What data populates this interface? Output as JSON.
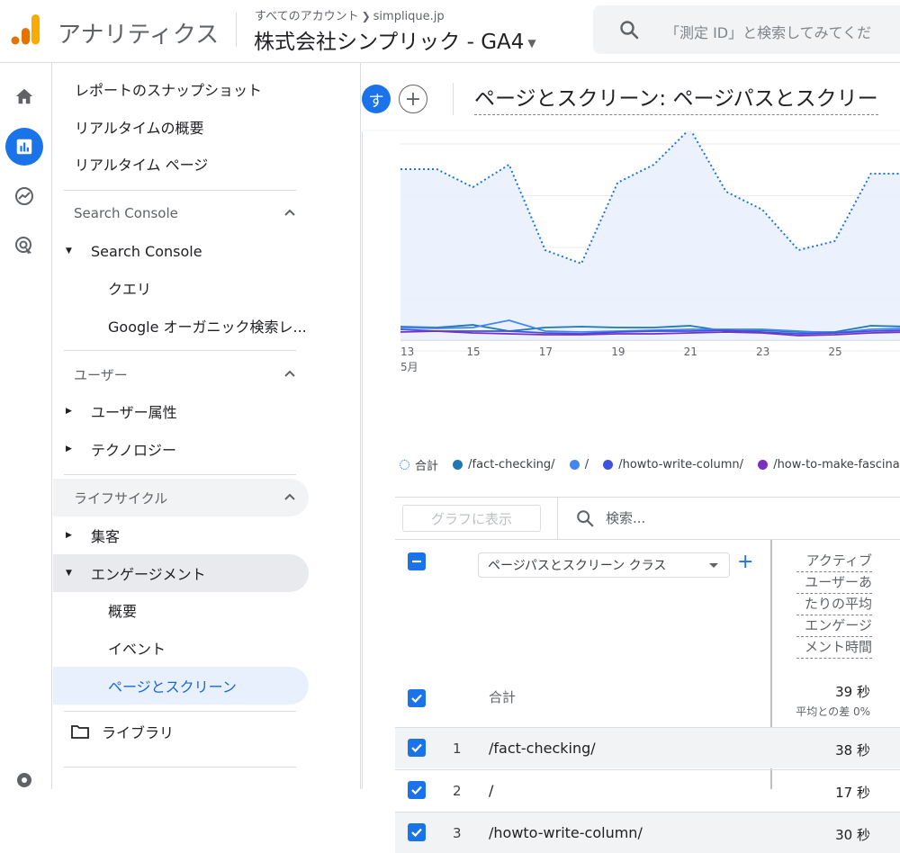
{
  "header": {
    "app_title": "アナリティクス",
    "account_path": "すべてのアカウント",
    "account_name": "simplique.jp",
    "property_name": "株式会社シンプリック - GA4",
    "search_placeholder": "「測定 ID」と検索してみてくだ"
  },
  "rail": {
    "items": [
      {
        "icon": "home-icon"
      },
      {
        "icon": "reports-icon",
        "active": true
      },
      {
        "icon": "explore-icon"
      },
      {
        "icon": "advertising-icon"
      },
      {
        "icon": "settings-icon"
      }
    ]
  },
  "nav": {
    "top_items": [
      "レポートのスナップショット",
      "リアルタイムの概要",
      "リアルタイム ページ"
    ],
    "sections": {
      "search_console": {
        "title": "Search Console",
        "group": "Search Console",
        "items": [
          "クエリ",
          "Google オーガニック検索レ..."
        ]
      },
      "user": {
        "title": "ユーザー",
        "items": [
          "ユーザー属性",
          "テクノロジー"
        ]
      },
      "lifecycle": {
        "title": "ライフサイクル",
        "items": [
          "集客",
          "エンゲージメント"
        ],
        "engagement_items": [
          "概要",
          "イベント",
          "ページとスクリーン"
        ]
      }
    },
    "library": "ライブラリ"
  },
  "main": {
    "avatar_letter": "す",
    "add_label": "+",
    "page_title": "ページとスクリーン: ページパスとスクリー"
  },
  "chart_data": {
    "type": "line",
    "x": [
      "13",
      "14",
      "15",
      "16",
      "17",
      "18",
      "19",
      "20",
      "21",
      "22",
      "23",
      "24",
      "25",
      "26",
      "27"
    ],
    "x_tick_labels": [
      "13",
      "15",
      "17",
      "19",
      "21",
      "23",
      "25"
    ],
    "x_month_label": "5月",
    "y_gridlines": 4,
    "ylim": [
      0,
      230
    ],
    "series": [
      {
        "name": "合計",
        "style": "dotted-area",
        "color": "#1a73e8",
        "values": [
          190,
          190,
          170,
          195,
          100,
          85,
          175,
          195,
          235,
          165,
          145,
          100,
          110,
          185,
          185
        ]
      },
      {
        "name": "/fact-checking/",
        "color": "#1f77b4",
        "values": [
          15,
          14,
          17,
          10,
          14,
          15,
          14,
          14,
          16,
          10,
          11,
          9,
          9,
          16,
          15
        ]
      },
      {
        "name": "/",
        "color": "#4285f4",
        "values": [
          14,
          13,
          14,
          22,
          10,
          9,
          10,
          11,
          12,
          12,
          12,
          10,
          8,
          12,
          13
        ]
      },
      {
        "name": "/howto-write-column/",
        "color": "#3f51e0",
        "values": [
          12,
          10,
          10,
          10,
          8,
          7,
          9,
          10,
          10,
          11,
          9,
          7,
          8,
          10,
          11
        ]
      },
      {
        "name": "/how-to-make-fascinating-",
        "color": "#7b2fbe",
        "values": [
          9,
          10,
          8,
          7,
          6,
          6,
          7,
          7,
          8,
          9,
          8,
          5,
          6,
          8,
          9
        ]
      }
    ],
    "legend_position": "bottom"
  },
  "filter": {
    "graph_button": "グラフに表示",
    "search_placeholder": "検索..."
  },
  "table": {
    "dimension_label": "ページパスとスクリーン クラス",
    "metric_header": [
      "アクティブ",
      "ユーザーあ",
      "たりの平均",
      "エンゲージ",
      "メント時間"
    ],
    "total_label": "合計",
    "total_value": "39 秒",
    "total_sub": "平均との差 0%",
    "rows": [
      {
        "rank": "1",
        "path": "/fact-checking/",
        "value": "38 秒"
      },
      {
        "rank": "2",
        "path": "/",
        "value": "17 秒"
      },
      {
        "rank": "3",
        "path": "/howto-write-column/",
        "value": "30 秒"
      }
    ]
  }
}
